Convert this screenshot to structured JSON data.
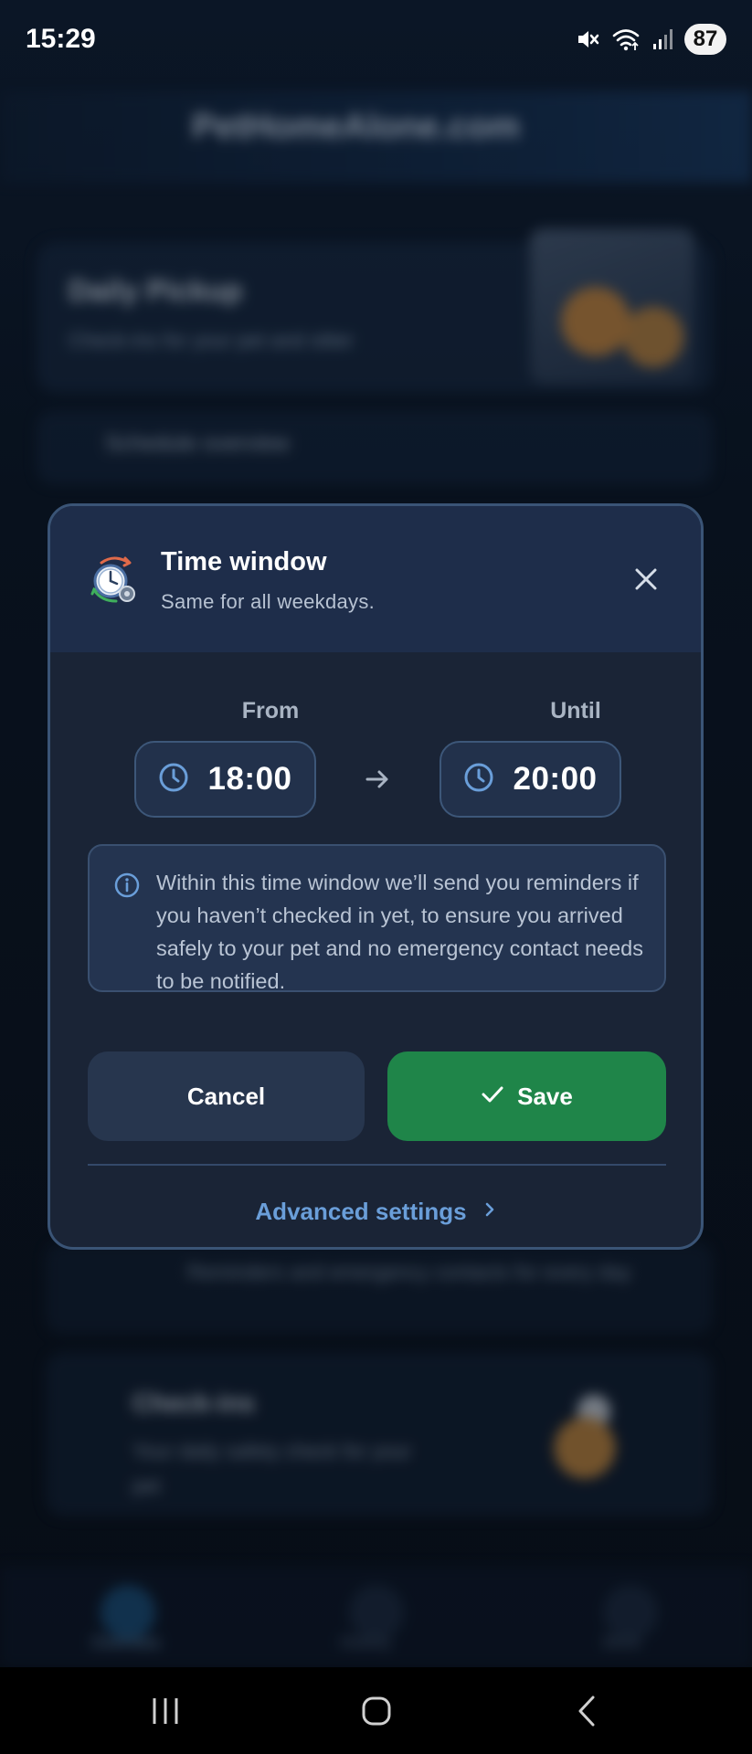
{
  "status_bar": {
    "time": "15:29",
    "battery": "87",
    "icons": [
      "mute-icon",
      "wifi-icon",
      "signal-icon"
    ]
  },
  "background": {
    "header_title": "PetHomeAlone.com",
    "card1_title": "Daily Pickup",
    "card1_sub": "Check-ins for your pet and sitter",
    "card2_label": "Schedule overview",
    "card3_text": "Reminders and emergency contacts for every day",
    "card4_title": "Check-ins",
    "card4_text": "Your daily safety check for your pet",
    "nav": [
      "Overview",
      "History",
      "More"
    ]
  },
  "dialog": {
    "title": "Time window",
    "subtitle": "Same for all weekdays.",
    "header_icon": "clock-settings-icon",
    "from_label": "From",
    "from_time": "18:00",
    "until_label": "Until",
    "until_time": "20:00",
    "info_text": "Within this time window we’ll send you reminders if you haven’t checked in yet, to ensure you arrived safely to your pet and no emergency contact needs to be notified.",
    "cancel_label": "Cancel",
    "save_label": "Save",
    "advanced_label": "Advanced settings"
  },
  "colors": {
    "dialog_bg": "#1a2436",
    "header_bg": "#1e2d4a",
    "accent_blue": "#6a9ed9",
    "save_green": "#1f8549",
    "cancel_bg": "#27364e"
  }
}
